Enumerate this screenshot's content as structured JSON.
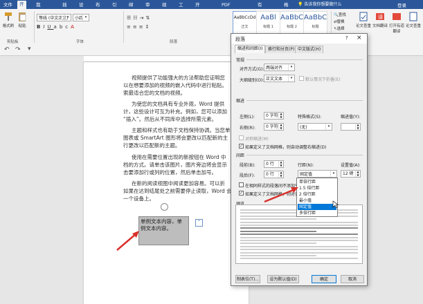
{
  "window": {
    "user": "登录",
    "share": "共享"
  },
  "tabs": [
    "开始",
    "插入",
    "设计",
    "布局",
    "引用",
    "邮件",
    "审阅",
    "视图",
    "工具",
    "开发工具",
    "PDF工具集",
    "有道翻译",
    "格式"
  ],
  "extra_tabs": [
    "我的模板"
  ],
  "active_tab": "开始",
  "search_hint": "告诉我你想要做什么",
  "ribbon": {
    "clipboard": {
      "label": "剪贴板",
      "paste": "粘贴",
      "format_painter": "格式刷"
    },
    "font": {
      "label": "字体",
      "name": "等线 (中文正文)",
      "size": "小四"
    },
    "paragraph": {
      "label": "段落"
    },
    "styles": {
      "label": "样式",
      "items": [
        {
          "preview": "AaBbCcDd",
          "name": "正文"
        },
        {
          "preview": "AaBl",
          "name": "标题 1"
        },
        {
          "preview": "AaBbC",
          "name": "标题 2"
        },
        {
          "preview": "AaBbC",
          "name": "标题"
        }
      ]
    },
    "editing": {
      "find": "查找",
      "replace": "替换",
      "select": "选择",
      "label": "编辑"
    },
    "right_buttons": [
      "论文查重",
      "有道翻译",
      "论文查重"
    ],
    "right_labels": [
      "文档翻译",
      "打开有道翻译"
    ]
  },
  "document": {
    "paragraphs": [
      "视频提供了功能强大的方法帮助您证明您",
      "以在想要添加的视频的嵌入代码中进行粘贴。",
      "索最适合您的文档的视频。",
      "为使您的文档具有专业外观，Word 提供",
      "计，这些设计可互为补充。例如，您可以添加",
      "“插入”。然后从不同库中选择所需元素。",
      "主题和样式也有助于文档保持协调。当您单",
      "图表或 SmartArt 图形将会更改以匹配新的主",
      "行更改以匹配新的主题。",
      "使用在需要位置出现的新按钮在 Word 中",
      "档的方式。请单击该图片，图片旁边将会显示",
      "击要添加行或列的位置，然后单击加号。",
      "在新的阅读视图中阅读更加容易。可以折",
      "如果在达到结尾处之前需要停止读取，Word 会",
      "一个设备上。"
    ],
    "selected_text": [
      "单例文本内容，单",
      "例文本内容。"
    ]
  },
  "dialog": {
    "title": "段落",
    "help": "?",
    "close": "×",
    "tabs": [
      "缩进和间距(I)",
      "换行和分页(P)",
      "中文版式(H)"
    ],
    "general": {
      "section": "常规",
      "alignment_label": "对齐方式(G):",
      "alignment_value": "两端对齐",
      "outline_label": "大纲级别(O):",
      "outline_value": "正文文本",
      "collapsed_label": "默认情况下折叠(E)"
    },
    "indent": {
      "section": "缩进",
      "left_label": "左侧(L):",
      "left_value": "0 字符",
      "right_label": "右侧(R):",
      "right_value": "0 字符",
      "special_label": "特殊格式(S):",
      "special_value": "(无)",
      "by_label": "缩进值(Y):",
      "mirror_label": "对称缩进(M)",
      "auto_adjust_label": "如果定义了文档网格，则自动调整右缩进(D)"
    },
    "spacing": {
      "section": "间距",
      "before_label": "段前(B):",
      "before_value": "0 行",
      "after_label": "段后(F):",
      "after_value": "0 行",
      "line_label": "行距(N):",
      "line_value": "固定值",
      "at_label": "设置值(A):",
      "at_value": "12 磅",
      "no_space_label": "在相同样式的段落间不添加空格(C)",
      "snap_label": "如果定义了文档网格，则对齐到网格(W)"
    },
    "line_spacing_options": [
      "单倍行距",
      "1.5 倍行距",
      "2 倍行距",
      "最小值",
      "固定值",
      "多倍行距"
    ],
    "line_spacing_selected": 4,
    "preview_label": "预览",
    "buttons": {
      "tabs": "制表位(T)...",
      "default": "设为默认值(D)",
      "ok": "确定",
      "cancel": "取消"
    }
  },
  "colors": {
    "accent": "#2b579a",
    "selection": "#0078d7",
    "arrow": "#d9302a"
  }
}
